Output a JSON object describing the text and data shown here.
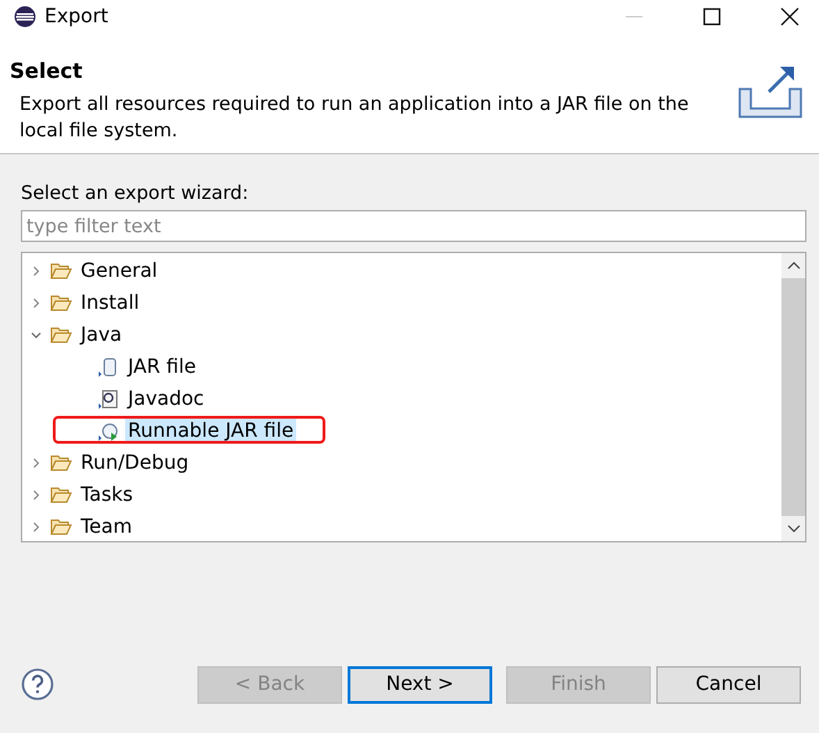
{
  "window": {
    "title": "Export"
  },
  "header": {
    "title": "Select",
    "description": "Export all resources required to run an application into a JAR file on the local file system."
  },
  "wizard_label": "Select an export wizard:",
  "filter": {
    "placeholder": "type filter text"
  },
  "tree": {
    "items": [
      {
        "label": "General",
        "kind": "folder",
        "expanded": false,
        "selected": false
      },
      {
        "label": "Install",
        "kind": "folder",
        "expanded": false,
        "selected": false
      },
      {
        "label": "Java",
        "kind": "folder",
        "expanded": true,
        "selected": false,
        "children": [
          {
            "label": "JAR file",
            "kind": "jar",
            "selected": false
          },
          {
            "label": "Javadoc",
            "kind": "javadoc",
            "selected": false
          },
          {
            "label": "Runnable JAR file",
            "kind": "runnable",
            "selected": true,
            "annotated": true
          }
        ]
      },
      {
        "label": "Run/Debug",
        "kind": "folder",
        "expanded": false,
        "selected": false
      },
      {
        "label": "Tasks",
        "kind": "folder",
        "expanded": false,
        "selected": false
      },
      {
        "label": "Team",
        "kind": "folder",
        "expanded": false,
        "selected": false
      }
    ]
  },
  "buttons": [
    {
      "label": "< Back",
      "disabled": true,
      "default": false
    },
    {
      "label": "Next >",
      "disabled": false,
      "default": true
    },
    {
      "label": "Finish",
      "disabled": true,
      "default": false
    },
    {
      "label": "Cancel",
      "disabled": false,
      "default": false
    }
  ]
}
